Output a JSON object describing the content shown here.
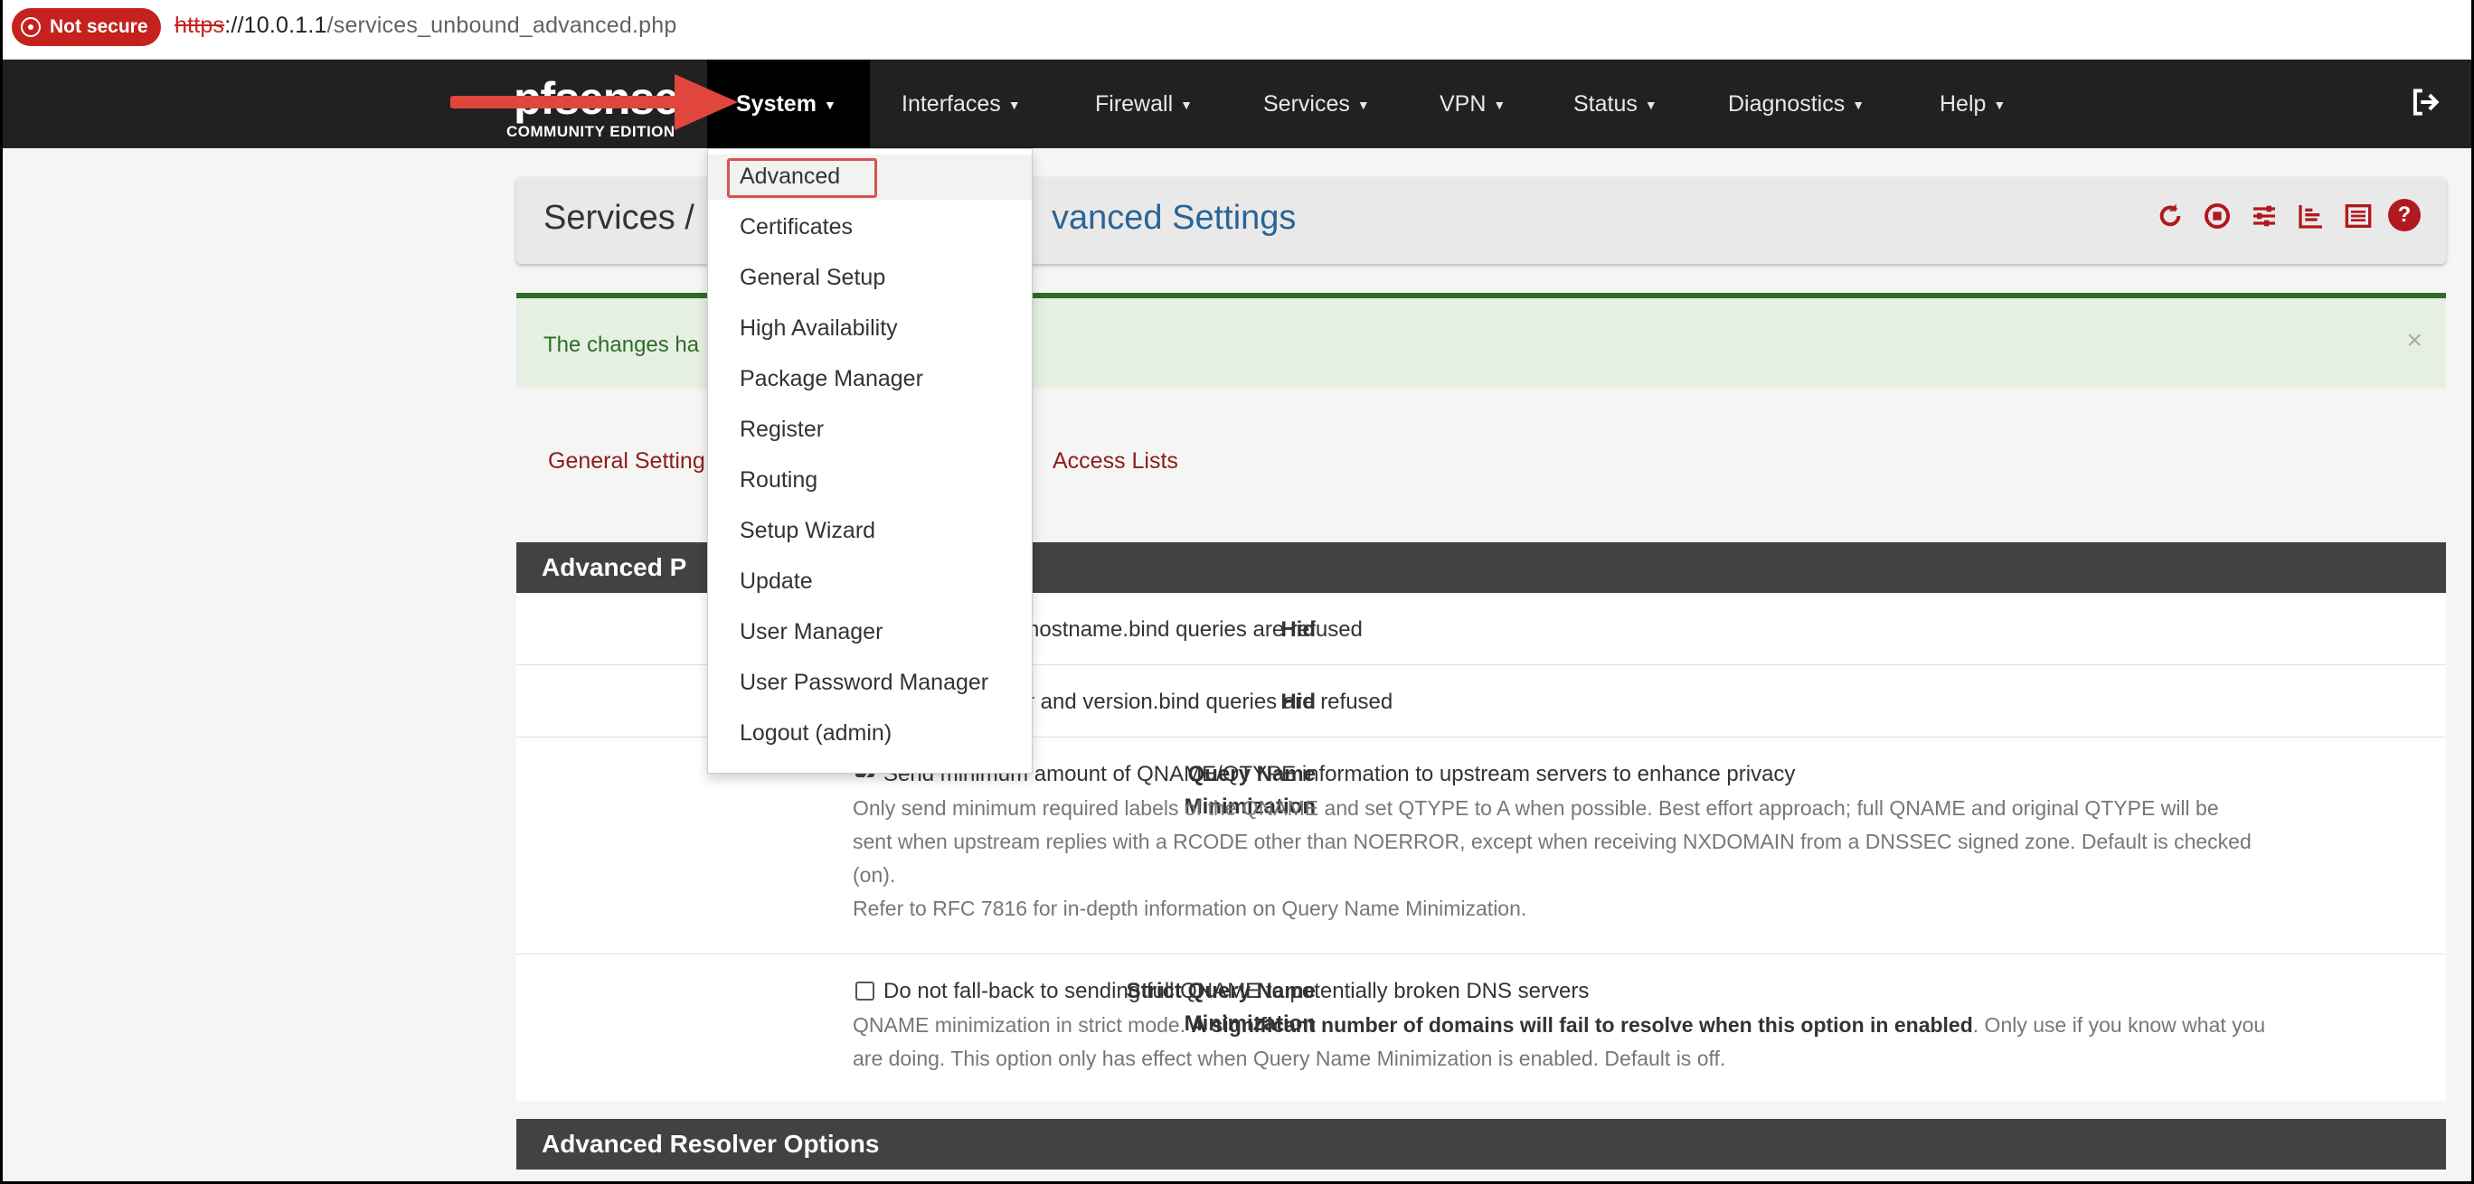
{
  "browser": {
    "security_label": "Not secure",
    "url_proto": "https",
    "url_host": "://10.0.1.1",
    "url_path": "/services_unbound_advanced.php"
  },
  "logo": {
    "main": "pfsense",
    "sub": "COMMUNITY EDITION"
  },
  "nav": {
    "items": [
      {
        "label": "System"
      },
      {
        "label": "Interfaces"
      },
      {
        "label": "Firewall"
      },
      {
        "label": "Services"
      },
      {
        "label": "VPN"
      },
      {
        "label": "Status"
      },
      {
        "label": "Diagnostics"
      },
      {
        "label": "Help"
      }
    ]
  },
  "dropdown": {
    "items": [
      "Advanced",
      "Certificates",
      "General Setup",
      "High Availability",
      "Package Manager",
      "Register",
      "Routing",
      "Setup Wizard",
      "Update",
      "User Manager",
      "User Password Manager",
      "Logout (admin)"
    ]
  },
  "header": {
    "crumb_services": "Services /",
    "crumb_rest": "vanced Settings"
  },
  "alert": {
    "text": "The changes ha"
  },
  "tabs": {
    "general": "General Setting",
    "access": "Access Lists"
  },
  "section1": {
    "title": "Advanced P",
    "hide_identity_label": "Hid",
    "hide_identity_text": "hostname.bind queries are refused",
    "hide_version_label": "Hid",
    "hide_version_text": "r and version.bind queries are refused",
    "qname_label_1": "Query Name",
    "qname_label_2": "Minimization",
    "qname_check_text": "Send minimum amount of QNAME/QTYPE information to upstream servers to enhance privacy",
    "qname_help_1": "Only send minimum required labels of the QNAME and set QTYPE to A when possible. Best effort approach; full QNAME and original QTYPE will be",
    "qname_help_2": "sent when upstream replies with a RCODE other than NOERROR, except when receiving NXDOMAIN from a DNSSEC signed zone. Default is checked",
    "qname_help_3": "(on).",
    "qname_help_4a": "Refer to ",
    "qname_help_4b": "RFC 7816",
    "qname_help_4c": " for in-depth information on Query Name Minimization.",
    "strict_label_1": "Strict Query Name",
    "strict_label_2": "Minimization",
    "strict_check_text": "Do not fall-back to sending full QNAME to potentially broken DNS servers",
    "strict_help_1a": "QNAME minimization in strict mode. ",
    "strict_help_1b": "A significant number of domains will fail to resolve when this option in enabled",
    "strict_help_1c": ". Only use if you know what you",
    "strict_help_2": "are doing. This option only has effect when Query Name Minimization is enabled. Default is off."
  },
  "section2": {
    "title": "Advanced Resolver Options"
  },
  "colors": {
    "accent": "#b0191e",
    "navbar": "#212121",
    "annotation": "#e0463c"
  }
}
